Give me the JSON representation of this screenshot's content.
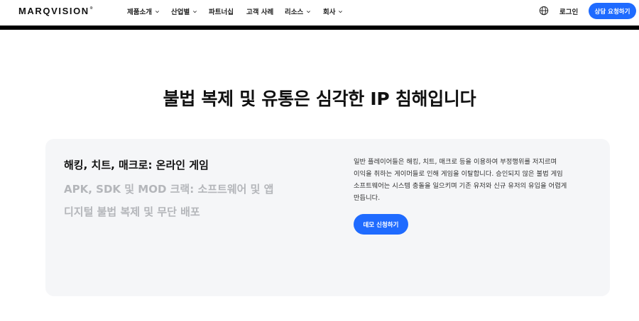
{
  "header": {
    "logo": "MARQVISION",
    "logo_mark": "®",
    "nav": [
      {
        "label": "제품소개",
        "has_dropdown": true
      },
      {
        "label": "산업별",
        "has_dropdown": true
      },
      {
        "label": "파트너십",
        "has_dropdown": false
      },
      {
        "label": "고객 사례",
        "has_dropdown": false
      },
      {
        "label": "리소스",
        "has_dropdown": true
      },
      {
        "label": "회사",
        "has_dropdown": true
      }
    ],
    "language_icon": "globe-icon",
    "login_label": "로그인",
    "cta_label": "상담 요청하기"
  },
  "main": {
    "heading": "불법 복제 및 유통은 심각한 IP 침해입니다",
    "tabs": [
      {
        "label": "해킹, 치트, 매크로: 온라인 게임",
        "active": true
      },
      {
        "label": "APK, SDK 및 MOD 크랙: 소프트웨어 및 앱",
        "active": false
      },
      {
        "label": "디지털 불법 복제 및 무단 배포",
        "active": false
      }
    ],
    "description_lines": [
      "일반 플레이어들은 해킹, 치트, 매크로 등을 이용하여 부정행위를 저지르며",
      "이익을 취하는 게이머들로 인해 게임을 이탈합니다. 승인되지 않은 불법 게임",
      "소프트웨어는 시스템 충돌을 일으키며 기존 유저와 신규 유저의 유입을 어렵게",
      "만듭니다."
    ],
    "demo_label": "데모 신청하기"
  },
  "colors": {
    "accent": "#1f6bff",
    "card_background": "#f5f6f8",
    "inactive_tab": "#b4b6ba",
    "divider": "#000000"
  }
}
